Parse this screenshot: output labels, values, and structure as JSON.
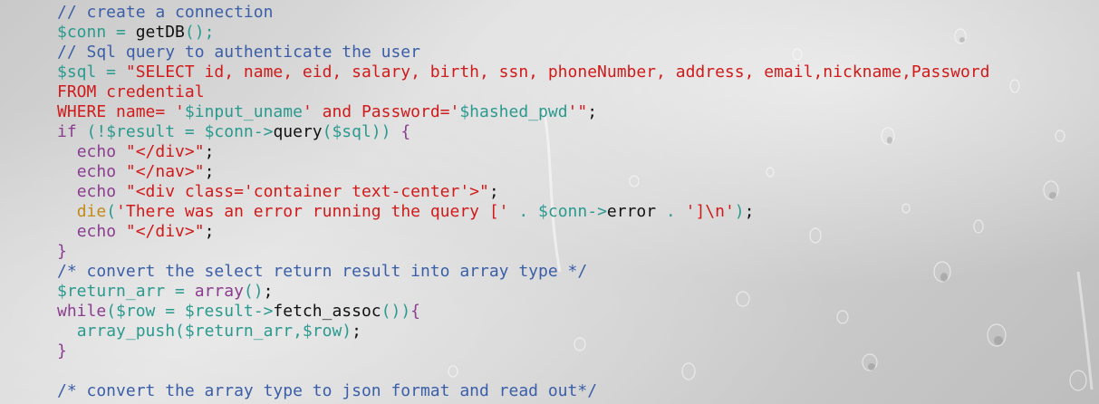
{
  "colors": {
    "comment": "#3a5ea8",
    "variable": "#2a9a8f",
    "string": "#d11a1a",
    "keyword": "#8a3d8f",
    "plain": "#111111",
    "die": "#c28a1a"
  },
  "lines": [
    {
      "indent": "",
      "segments": [
        {
          "cls": "c",
          "text": "// create a connection"
        }
      ]
    },
    {
      "indent": "",
      "segments": [
        {
          "cls": "v",
          "text": "$conn = "
        },
        {
          "cls": "f",
          "text": "getDB"
        },
        {
          "cls": "v",
          "text": "();"
        }
      ]
    },
    {
      "indent": "",
      "segments": [
        {
          "cls": "c",
          "text": "// Sql query to authenticate the user"
        }
      ]
    },
    {
      "indent": "",
      "segments": [
        {
          "cls": "v",
          "text": "$sql = "
        },
        {
          "cls": "s",
          "text": "\"SELECT id, name, eid, salary, birth, ssn, phoneNumber, address, email,nickname,Password"
        }
      ]
    },
    {
      "indent": "",
      "segments": [
        {
          "cls": "s",
          "text": "FROM credential"
        }
      ]
    },
    {
      "indent": "",
      "segments": [
        {
          "cls": "s",
          "text": "WHERE name= '"
        },
        {
          "cls": "v",
          "text": "$input_uname"
        },
        {
          "cls": "s",
          "text": "' and Password='"
        },
        {
          "cls": "v",
          "text": "$hashed_pwd"
        },
        {
          "cls": "s",
          "text": "'\""
        },
        {
          "cls": "p",
          "text": ";"
        }
      ]
    },
    {
      "indent": "",
      "segments": [
        {
          "cls": "k",
          "text": "if"
        },
        {
          "cls": "v",
          "text": " (!$result = $conn->"
        },
        {
          "cls": "f",
          "text": "query"
        },
        {
          "cls": "v",
          "text": "($sql)) "
        },
        {
          "cls": "k",
          "text": "{"
        }
      ]
    },
    {
      "indent": "  ",
      "segments": [
        {
          "cls": "k",
          "text": "echo "
        },
        {
          "cls": "s",
          "text": "\"</div>\""
        },
        {
          "cls": "p",
          "text": ";"
        }
      ]
    },
    {
      "indent": "  ",
      "segments": [
        {
          "cls": "k",
          "text": "echo "
        },
        {
          "cls": "s",
          "text": "\"</nav>\""
        },
        {
          "cls": "p",
          "text": ";"
        }
      ]
    },
    {
      "indent": "  ",
      "segments": [
        {
          "cls": "k",
          "text": "echo "
        },
        {
          "cls": "s",
          "text": "\"<div class='container text-center'>\""
        },
        {
          "cls": "p",
          "text": ";"
        }
      ]
    },
    {
      "indent": "  ",
      "segments": [
        {
          "cls": "e",
          "text": "die"
        },
        {
          "cls": "v",
          "text": "("
        },
        {
          "cls": "s",
          "text": "'There was an error running the query ['"
        },
        {
          "cls": "v",
          "text": " . $conn->"
        },
        {
          "cls": "f",
          "text": "error"
        },
        {
          "cls": "v",
          "text": " . "
        },
        {
          "cls": "s",
          "text": "']\\n'"
        },
        {
          "cls": "v",
          "text": ")"
        },
        {
          "cls": "p",
          "text": ";"
        }
      ]
    },
    {
      "indent": "  ",
      "segments": [
        {
          "cls": "k",
          "text": "echo "
        },
        {
          "cls": "s",
          "text": "\"</div>\""
        },
        {
          "cls": "p",
          "text": ";"
        }
      ]
    },
    {
      "indent": "",
      "segments": [
        {
          "cls": "k",
          "text": "}"
        }
      ]
    },
    {
      "indent": "",
      "segments": [
        {
          "cls": "c",
          "text": "/* convert the select return result into array type */"
        }
      ]
    },
    {
      "indent": "",
      "segments": [
        {
          "cls": "v",
          "text": "$return_arr = "
        },
        {
          "cls": "k",
          "text": "array"
        },
        {
          "cls": "v",
          "text": "()"
        },
        {
          "cls": "p",
          "text": ";"
        }
      ]
    },
    {
      "indent": "",
      "segments": [
        {
          "cls": "k",
          "text": "while"
        },
        {
          "cls": "v",
          "text": "($row = $result->"
        },
        {
          "cls": "f",
          "text": "fetch_assoc"
        },
        {
          "cls": "v",
          "text": "())"
        },
        {
          "cls": "k",
          "text": "{"
        }
      ]
    },
    {
      "indent": "  ",
      "segments": [
        {
          "cls": "v",
          "text": "array_push($return_arr,$row)"
        },
        {
          "cls": "p",
          "text": ";"
        }
      ]
    },
    {
      "indent": "",
      "segments": [
        {
          "cls": "k",
          "text": "}"
        }
      ]
    },
    {
      "indent": "",
      "segments": []
    },
    {
      "indent": "",
      "segments": [
        {
          "cls": "c",
          "text": "/* convert the array type to json format and read out*/"
        }
      ]
    }
  ]
}
